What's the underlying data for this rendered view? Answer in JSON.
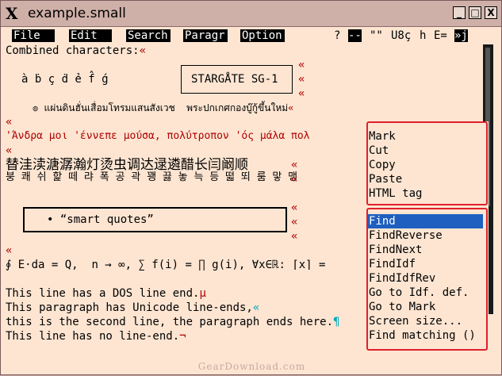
{
  "window": {
    "title": "example.small",
    "min_btn": "_",
    "max_btn": "□",
    "close_btn": "X"
  },
  "menubar": {
    "items": [
      "File",
      "Edit",
      "Search",
      "Paragr",
      "Option"
    ],
    "status": {
      "q": "?",
      "dashes": "--",
      "quotes": "\"\"",
      "enc": "U8ç",
      "h": "h",
      "e": "E=",
      "last": "»j"
    }
  },
  "text": {
    "l1": "Combined characters:",
    "combining_chars": "à ḃ ç ḋ ẻ f̂ ǵ",
    "stargate": "STARGÅTE SG-1",
    "thai": "๏ แผ่นดินฮั่นเสื่อมโทรมแสนสังเวช  พระปกเกศกองบู๊กู้ขึ้นใหม่",
    "greek": "'Άνδρα μοι 'έννεπε μούσα, πολύτροπον 'ός μάλα πολ",
    "cjk": "替洼渎溏潺瀚灯烫虫调达逯遴醋长闫阚顺",
    "hangul": "붕 쾌 쉬 핥 떼 랴 폭 공 곽 꽹 끓 놓 늑 등 떫 뙤 룸 맣 맹",
    "smart_quotes": "“smart quotes”",
    "math": "∮ E⋅da = Q,  n → ∞, ∑ f(i) = ∏ g(i), ∀x∈ℝ: ⌈x⌉ =",
    "dos": "This line has a DOS line end.",
    "unicode_ends": "This paragraph has Unicode line-ends,",
    "second_line": "this is the second line, the paragraph ends here.",
    "no_end": "This line has no line-end.",
    "guillemet": "«",
    "mu": "µ",
    "pilcrow": "¶",
    "not_sign": "¬"
  },
  "popup": {
    "group1": [
      "Mark",
      "Cut",
      "Copy",
      "Paste",
      "HTML tag"
    ],
    "group2": [
      "Find",
      "FindReverse",
      "FindNext",
      "FindIdf",
      "FindIdfRev",
      "Go to Idf. def.",
      "Go to Mark",
      "Screen size...",
      "Find matching ()"
    ],
    "selected": "Find"
  },
  "watermark": "GearDownload.com",
  "colors": {
    "background": "#fde5d2",
    "selection": "#1f5fc0",
    "highlight_box": "#e0202a",
    "line_end": "#b00000"
  }
}
